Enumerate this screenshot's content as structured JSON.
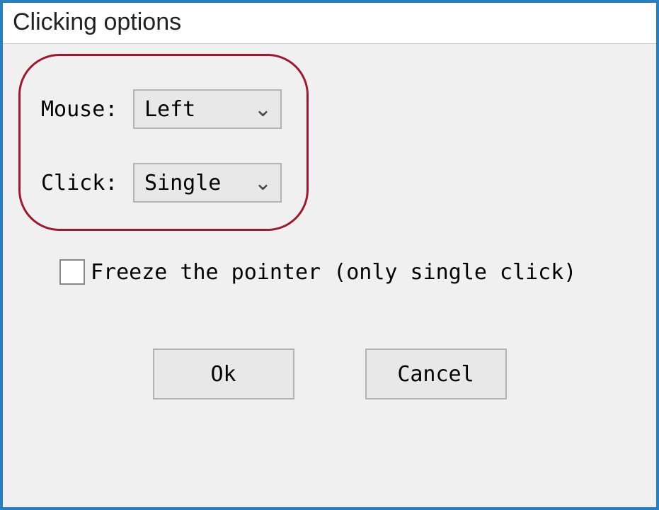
{
  "window": {
    "title": "Clicking options"
  },
  "form": {
    "mouse_label": "Mouse:",
    "mouse_value": "Left",
    "click_label": "Click:",
    "click_value": "Single",
    "freeze_label": "Freeze the pointer (only single click)",
    "freeze_checked": false
  },
  "buttons": {
    "ok": "Ok",
    "cancel": "Cancel"
  }
}
